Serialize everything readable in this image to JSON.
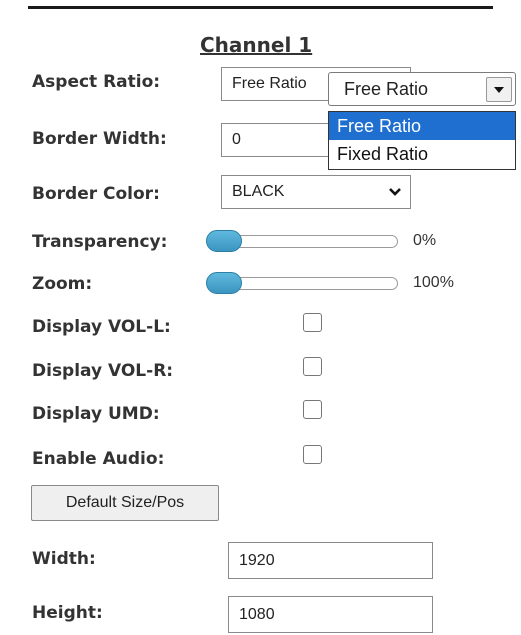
{
  "channel_title": "Channel 1",
  "aspect_ratio": {
    "label": "Aspect Ratio:",
    "value_behind": "Free Ratio",
    "dropdown": {
      "selected": "Free Ratio",
      "options": [
        "Free Ratio",
        "Fixed Ratio"
      ],
      "highlighted_index": 0
    }
  },
  "border_width": {
    "label": "Border Width:",
    "value": "0"
  },
  "border_color": {
    "label": "Border Color:",
    "value": "BLACK"
  },
  "transparency": {
    "label": "Transparency:",
    "value_text": "0%",
    "level": 0
  },
  "zoom": {
    "label": "Zoom:",
    "value_text": "100%",
    "level": 0
  },
  "checkboxes": [
    {
      "label": "Display VOL-L:",
      "checked": false
    },
    {
      "label": "Display VOL-R:",
      "checked": false
    },
    {
      "label": "Display UMD:",
      "checked": false
    },
    {
      "label": "Enable Audio:",
      "checked": false
    }
  ],
  "default_button": "Default Size/Pos",
  "width": {
    "label": "Width:",
    "value": "1920"
  },
  "height": {
    "label": "Height:",
    "value": "1080"
  },
  "icons": {
    "dropdown_arrow": "caret-down-icon",
    "select_chevron": "chevron-down-icon"
  },
  "colors": {
    "slider_thumb": "#4aa7d0",
    "highlight": "#1e6fd0"
  }
}
